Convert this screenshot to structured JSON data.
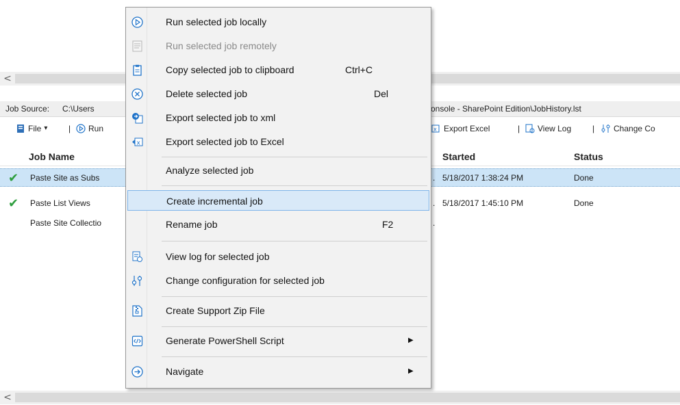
{
  "scroll_arrow": "<",
  "job_source": {
    "label": "Job Source:",
    "path_start": "C:\\Users",
    "path_end": "onsole - SharePoint Edition\\JobHistory.lst"
  },
  "toolbar": {
    "file_label": "File",
    "file_caret": "▾",
    "separator": "|",
    "run_label": "Run",
    "export_excel_label": "Export Excel",
    "view_log_label": "View Log",
    "change_config_label": "Change Co"
  },
  "grid": {
    "columns": {
      "job_name": "Job Name",
      "started": "Started",
      "status": "Status"
    },
    "rows": [
      {
        "name": "Paste Site as Subs",
        "ellipsis": ".",
        "started": "5/18/2017 1:38:24 PM",
        "status": "Done",
        "done": true
      },
      {
        "name": "Paste List Views",
        "ellipsis": ".",
        "started": "5/18/2017 1:45:10 PM",
        "status": "Done",
        "done": true
      },
      {
        "name": "Paste Site Collectio",
        "ellipsis": ".",
        "started": "",
        "status": "",
        "done": false
      }
    ]
  },
  "context_menu": {
    "items": [
      {
        "label": "Run selected job locally",
        "shortcut": "",
        "icon": "run-circle-icon"
      },
      {
        "label": "Run selected job remotely",
        "shortcut": "",
        "icon": "run-remote-icon",
        "disabled": true
      },
      {
        "label": "Copy selected job to clipboard",
        "shortcut": "Ctrl+C",
        "icon": "clipboard-icon"
      },
      {
        "label": "Delete selected job",
        "shortcut": "Del",
        "icon": "delete-circle-icon"
      },
      {
        "label": "Export selected job to xml",
        "shortcut": "",
        "icon": "export-xml-icon"
      },
      {
        "label": "Export selected job to Excel",
        "shortcut": "",
        "icon": "export-excel-icon"
      },
      {
        "label": "Analyze selected job",
        "shortcut": ""
      },
      {
        "label": "Create incremental job",
        "shortcut": "",
        "highlighted": true
      },
      {
        "label": "Rename job",
        "shortcut": "F2"
      },
      {
        "label": "View log for selected job",
        "shortcut": "",
        "icon": "view-log-icon"
      },
      {
        "label": "Change configuration for selected job",
        "shortcut": "",
        "icon": "configuration-icon"
      },
      {
        "label": "Create Support Zip File",
        "shortcut": "",
        "icon": "zip-file-icon"
      },
      {
        "label": "Generate PowerShell Script",
        "shortcut": "",
        "icon": "script-icon",
        "submenu_arrow": "▶"
      },
      {
        "label": "Navigate",
        "shortcut": "",
        "icon": "navigate-arrow-icon",
        "submenu_arrow": "▶"
      }
    ]
  },
  "colors": {
    "selection_row": "#cce4f7",
    "menu_highlight": "#d9e9f8",
    "menu_highlight_border": "#7eb4ea",
    "icon_blue": "#1f73c9",
    "check_green": "#2e9e3e"
  }
}
